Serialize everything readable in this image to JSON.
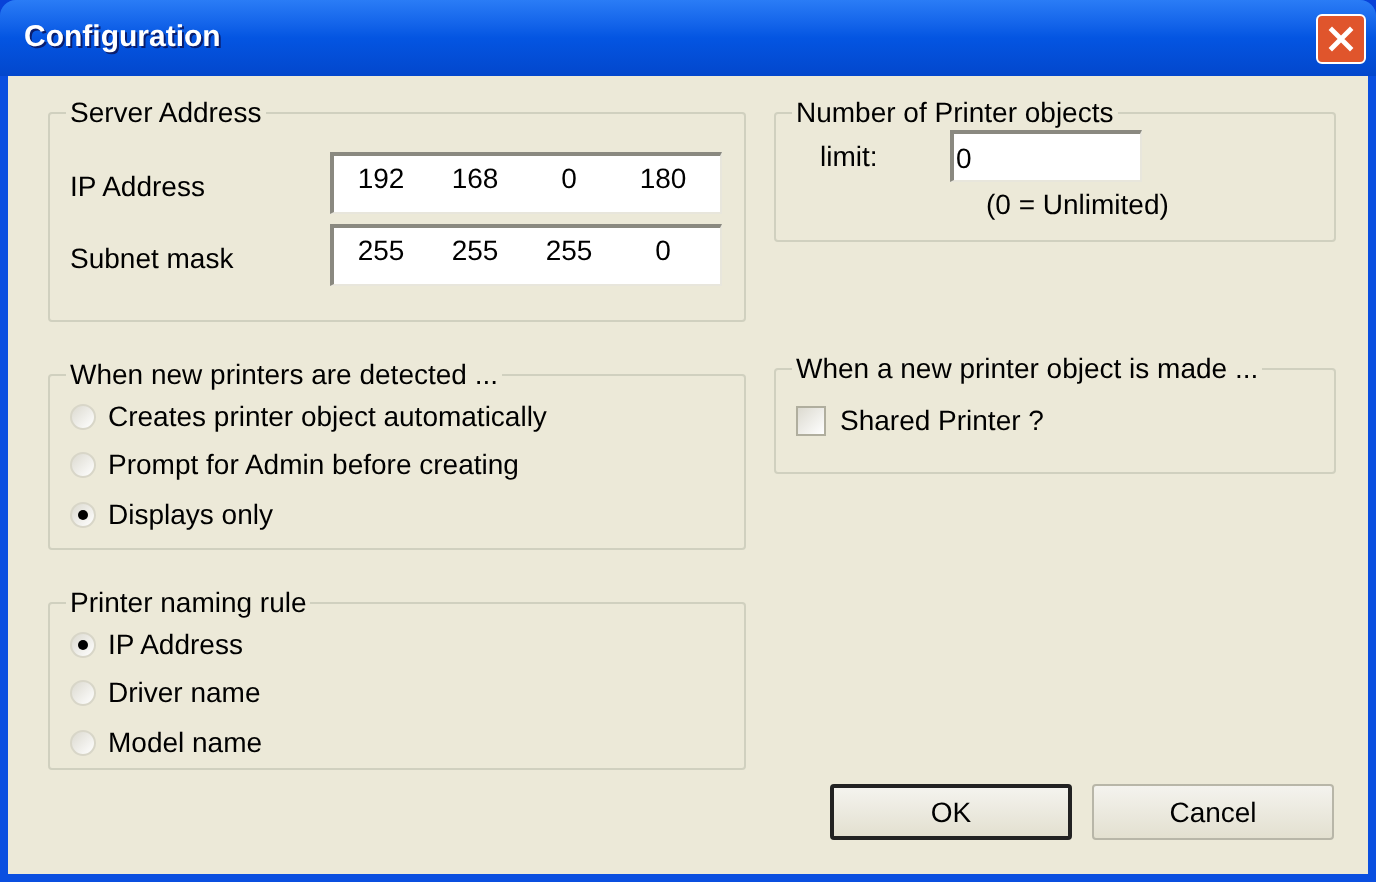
{
  "window": {
    "title": "Configuration"
  },
  "server_address": {
    "title": "Server Address",
    "fields": [
      {
        "label": "IP Address",
        "octets": [
          "192",
          "168",
          "0",
          "180"
        ]
      },
      {
        "label": "Subnet mask",
        "octets": [
          "255",
          "255",
          "255",
          "0"
        ]
      }
    ]
  },
  "detection": {
    "title": "When new printers are detected ...",
    "options": [
      {
        "label": "Creates printer object automatically",
        "selected": false
      },
      {
        "label": "Prompt for Admin before creating",
        "selected": false
      },
      {
        "label": "Displays only",
        "selected": true
      }
    ]
  },
  "naming_rule": {
    "title": "Printer naming rule",
    "options": [
      {
        "label": "IP Address",
        "selected": true
      },
      {
        "label": "Driver name",
        "selected": false
      },
      {
        "label": "Model name",
        "selected": false
      }
    ]
  },
  "printer_objects": {
    "title": "Number of Printer objects",
    "limit_label": "limit:",
    "limit_value": "0",
    "hint": "(0 = Unlimited)"
  },
  "new_object": {
    "title": "When a new printer object is made ...",
    "checkbox": {
      "label": "Shared Printer ?",
      "checked": false
    }
  },
  "buttons": [
    {
      "label": "OK",
      "default": true
    },
    {
      "label": "Cancel",
      "default": false
    }
  ]
}
